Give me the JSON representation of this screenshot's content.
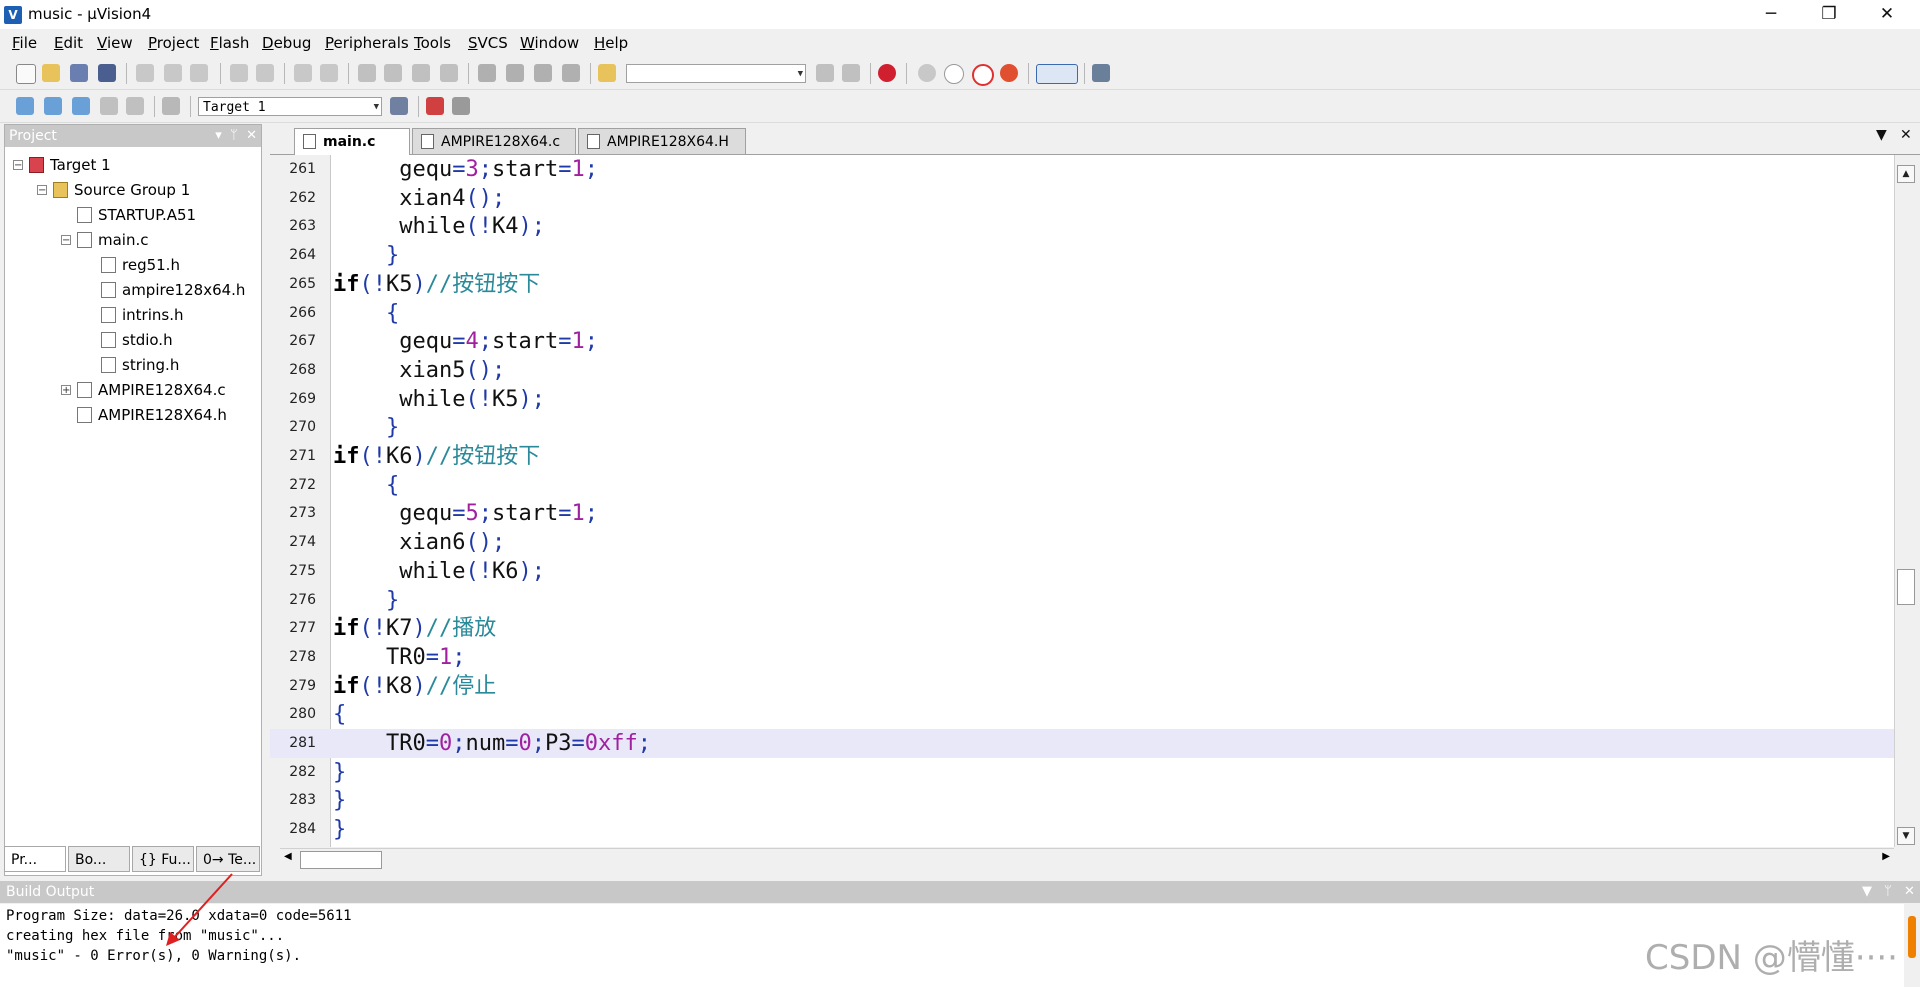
{
  "window": {
    "title": "music - µVision4",
    "minimize": "─",
    "restore": "❐",
    "close": "✕"
  },
  "menu": [
    "File",
    "Edit",
    "View",
    "Project",
    "Flash",
    "Debug",
    "Peripherals",
    "Tools",
    "SVCS",
    "Window",
    "Help"
  ],
  "toolbar": {
    "target_select": "Target 1",
    "find_combo": ""
  },
  "project_panel": {
    "title": "Project",
    "tree": [
      {
        "label": "Target 1",
        "icon": "target-icon",
        "indent": 0,
        "expander": "-"
      },
      {
        "label": "Source Group 1",
        "icon": "folder-icon",
        "indent": 1,
        "expander": "-"
      },
      {
        "label": "STARTUP.A51",
        "icon": "file-icon",
        "indent": 2,
        "expander": ""
      },
      {
        "label": "main.c",
        "icon": "file-icon",
        "indent": 2,
        "expander": "-"
      },
      {
        "label": "reg51.h",
        "icon": "file-icon",
        "indent": 3,
        "expander": ""
      },
      {
        "label": "ampire128x64.h",
        "icon": "file-icon",
        "indent": 3,
        "expander": ""
      },
      {
        "label": "intrins.h",
        "icon": "file-icon",
        "indent": 3,
        "expander": ""
      },
      {
        "label": "stdio.h",
        "icon": "file-icon",
        "indent": 3,
        "expander": ""
      },
      {
        "label": "string.h",
        "icon": "file-icon",
        "indent": 3,
        "expander": ""
      },
      {
        "label": "AMPIRE128X64.c",
        "icon": "file-icon",
        "indent": 2,
        "expander": "+"
      },
      {
        "label": "AMPIRE128X64.h",
        "icon": "file-icon",
        "indent": 2,
        "expander": ""
      }
    ],
    "tabs": [
      "Pr...",
      "Bo...",
      "{} Fu...",
      "0→ Te..."
    ]
  },
  "editor": {
    "tabs": [
      {
        "label": "main.c",
        "active": true
      },
      {
        "label": "AMPIRE128X64.c",
        "active": false
      },
      {
        "label": "AMPIRE128X64.H",
        "active": false
      }
    ],
    "current_line": 281,
    "lines": [
      {
        "n": "261",
        "code": "     gequ=3;start=1;"
      },
      {
        "n": "262",
        "code": "     xian4();"
      },
      {
        "n": "263",
        "code": "     while(!K4);"
      },
      {
        "n": "264",
        "code": "    }"
      },
      {
        "n": "265",
        "code": "if(!K5)//按钮按下"
      },
      {
        "n": "266",
        "code": "    {"
      },
      {
        "n": "267",
        "code": "     gequ=4;start=1;"
      },
      {
        "n": "268",
        "code": "     xian5();"
      },
      {
        "n": "269",
        "code": "     while(!K5);"
      },
      {
        "n": "270",
        "code": "    }"
      },
      {
        "n": "271",
        "code": "if(!K6)//按钮按下"
      },
      {
        "n": "272",
        "code": "    {"
      },
      {
        "n": "273",
        "code": "     gequ=5;start=1;"
      },
      {
        "n": "274",
        "code": "     xian6();"
      },
      {
        "n": "275",
        "code": "     while(!K6);"
      },
      {
        "n": "276",
        "code": "    }"
      },
      {
        "n": "277",
        "code": "if(!K7)//播放"
      },
      {
        "n": "278",
        "code": "    TR0=1;"
      },
      {
        "n": "279",
        "code": "if(!K8)//停止"
      },
      {
        "n": "280",
        "code": "{"
      },
      {
        "n": "281",
        "code": "    TR0=0;num=0;P3=0xff;"
      },
      {
        "n": "282",
        "code": "}"
      },
      {
        "n": "283",
        "code": "}"
      },
      {
        "n": "284",
        "code": "}"
      }
    ]
  },
  "build_output": {
    "title": "Build Output",
    "lines": [
      "Program Size: data=26.0 xdata=0 code=5611",
      "creating hex file from \"music\"...",
      "\"music\" - 0 Error(s), 0 Warning(s)."
    ]
  },
  "watermark": "CSDN @懵懂····",
  "colors": {
    "keyword": "#000000",
    "number": "#a020a0",
    "comment": "#2a8a9a",
    "operator": "#1f3aa8",
    "current_line": "#e8e8f8",
    "panel_header": "#c8c8c8",
    "accent_arrow": "#e02020"
  }
}
